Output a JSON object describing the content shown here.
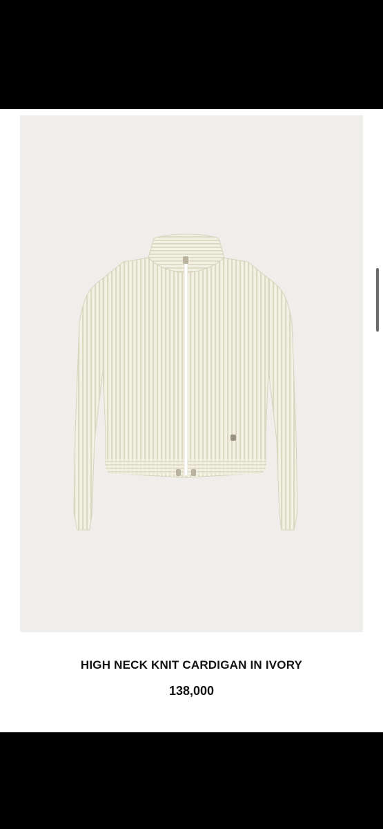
{
  "product": {
    "name": "HIGH NECK KNIT CARDIGAN IN IVORY",
    "price": "138,000",
    "image_icon": "cardigan-photo"
  },
  "colors": {
    "photo_background": "#efeeeb",
    "garment": "#f2f0e2"
  }
}
